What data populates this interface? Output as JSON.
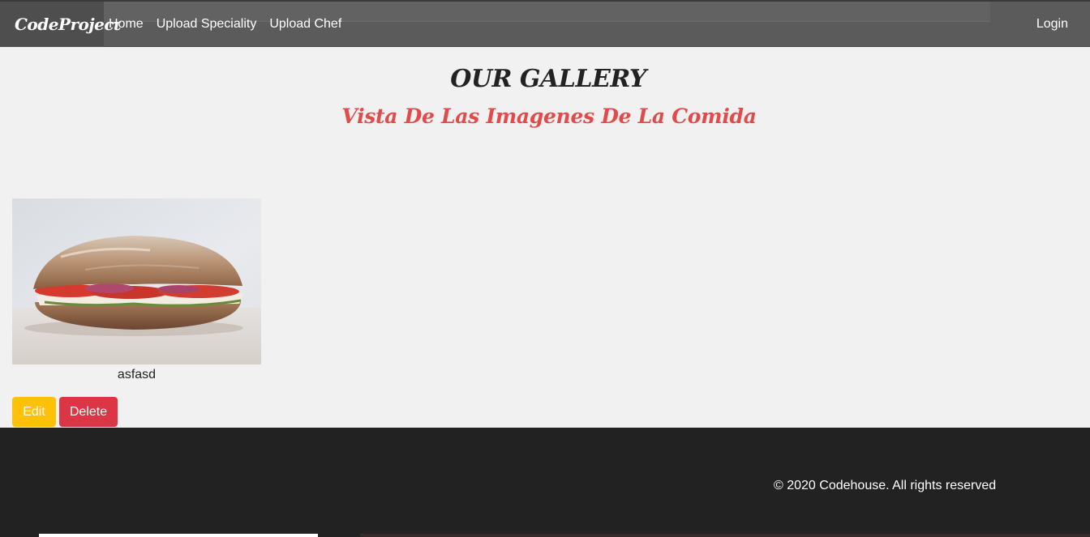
{
  "navbar": {
    "brand": "CodeProject",
    "links": [
      "Home",
      "Upload Speciality",
      "Upload Chef"
    ],
    "login_label": "Login"
  },
  "header": {
    "title": "OUR GALLERY",
    "subtitle": "Vista De Las Imagenes De La Comida"
  },
  "gallery": {
    "items": [
      {
        "caption": "asfasd",
        "image_alt": "sandwich photo",
        "edit_label": "Edit",
        "delete_label": "Delete"
      }
    ]
  },
  "footer": {
    "copyright": "© 2020 Codehouse. All rights reserved"
  },
  "colors": {
    "navbar_bg": "#5b5b5b",
    "subtitle": "#e34b4b",
    "edit_button": "#ffc107",
    "delete_button": "#dc3545",
    "footer_bg": "#222222"
  }
}
